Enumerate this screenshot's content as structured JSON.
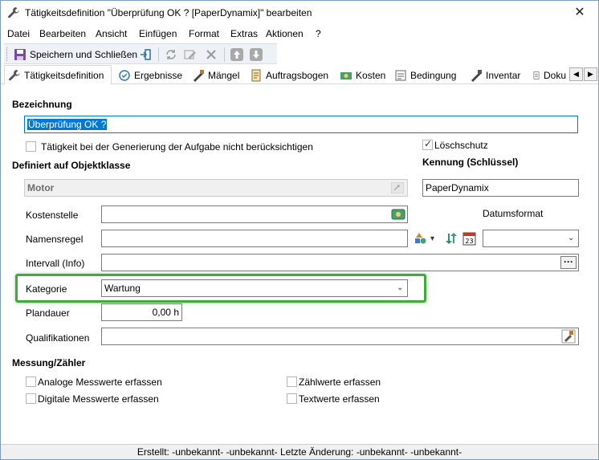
{
  "window": {
    "title": "Tätigkeitsdefinition \"Überprüfung OK ? [PaperDynamix]\" bearbeiten",
    "close_label": "✕"
  },
  "menu": [
    {
      "label": "Datei"
    },
    {
      "label": "Bearbeiten"
    },
    {
      "label": "Ansicht"
    },
    {
      "label": "Einfügen"
    },
    {
      "label": "Format"
    },
    {
      "label": "Extras"
    },
    {
      "label": "Aktionen"
    },
    {
      "label": "?"
    }
  ],
  "toolbar": {
    "save_close_label": "Speichern und Schließen"
  },
  "tabs": [
    {
      "label": "Tätigkeitsdefinition",
      "icon": "wrench-icon",
      "active": true
    },
    {
      "label": "Ergebnisse",
      "icon": "results-icon"
    },
    {
      "label": "Mängel",
      "icon": "defects-icon"
    },
    {
      "label": "Auftragsbogen",
      "icon": "order-sheet-icon"
    },
    {
      "label": "Kosten",
      "icon": "costs-icon"
    },
    {
      "label": "Bedingung",
      "icon": "condition-icon"
    },
    {
      "label": "Inventar",
      "icon": "inventory-icon"
    },
    {
      "label": "Doku",
      "icon": "document-icon"
    }
  ],
  "form": {
    "bezeichnung_label": "Bezeichnung",
    "bezeichnung_value": "Überprüfung OK ?",
    "ignore_task_label": "Tätigkeit bei der Generierung der Aufgabe nicht berücksichtigen",
    "loeschschutz_label": "Löschschutz",
    "loeschschutz_checked": true,
    "objektklasse_label": "Definiert auf Objektklasse",
    "objektklasse_value": "Motor",
    "kennung_label": "Kennung (Schlüssel)",
    "kennung_value": "PaperDynamix",
    "kostenstelle_label": "Kostenstelle",
    "kostenstelle_value": "",
    "datumsformat_label": "Datumsformat",
    "datumsformat_value": "",
    "namensregel_label": "Namensregel",
    "namensregel_value": "",
    "intervall_label": "Intervall (Info)",
    "intervall_value": "",
    "intervall_button": "···",
    "kategorie_label": "Kategorie",
    "kategorie_value": "Wartung",
    "plandauer_label": "Plandauer",
    "plandauer_value": "0,00 h",
    "qualifikationen_label": "Qualifikationen",
    "qualifikationen_value": "",
    "messung_label": "Messung/Zähler",
    "analoge_label": "Analoge Messwerte erfassen",
    "digitale_label": "Digitale Messwerte erfassen",
    "zaehlwerte_label": "Zählwerte erfassen",
    "textwerte_label": "Textwerte erfassen"
  },
  "status": {
    "text": "Erstellt: -unbekannt- -unbekannt-  Letzte Änderung: -unbekannt- -unbekannt-"
  },
  "colors": {
    "highlight_frame": "#3faa3a",
    "selection": "#0078d7"
  }
}
